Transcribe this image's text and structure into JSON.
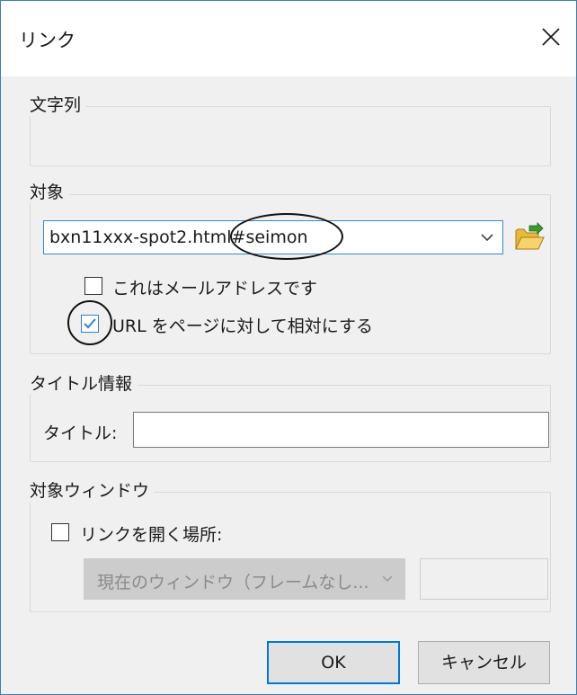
{
  "dialog": {
    "title": "リンク",
    "close_symbol": "✕"
  },
  "text_group": {
    "label": "文字列"
  },
  "target_group": {
    "label": "対象",
    "url_value": "bxn11xxx-spot2.html#seimon",
    "email_checkbox": {
      "label": "これはメールアドレスです",
      "checked": false
    },
    "relative_checkbox": {
      "label": "URL をページに対して相対にする",
      "checked": true
    }
  },
  "title_group": {
    "label": "タイトル情報",
    "title_field_label": "タイトル:",
    "title_value": ""
  },
  "window_group": {
    "label": "対象ウィンドウ",
    "open_checkbox": {
      "label": "リンクを開く場所:",
      "checked": false
    },
    "window_select_value": "現在のウィンドウ（フレームなし..."
  },
  "buttons": {
    "ok": "OK",
    "cancel": "キャンセル"
  },
  "colors": {
    "accent": "#0078d7",
    "dialog_bg": "#f0f0f0"
  },
  "icons": {
    "close": "close-icon",
    "dropdown": "chevron-down-icon",
    "browse": "folder-open-icon",
    "check": "checkmark-icon"
  }
}
